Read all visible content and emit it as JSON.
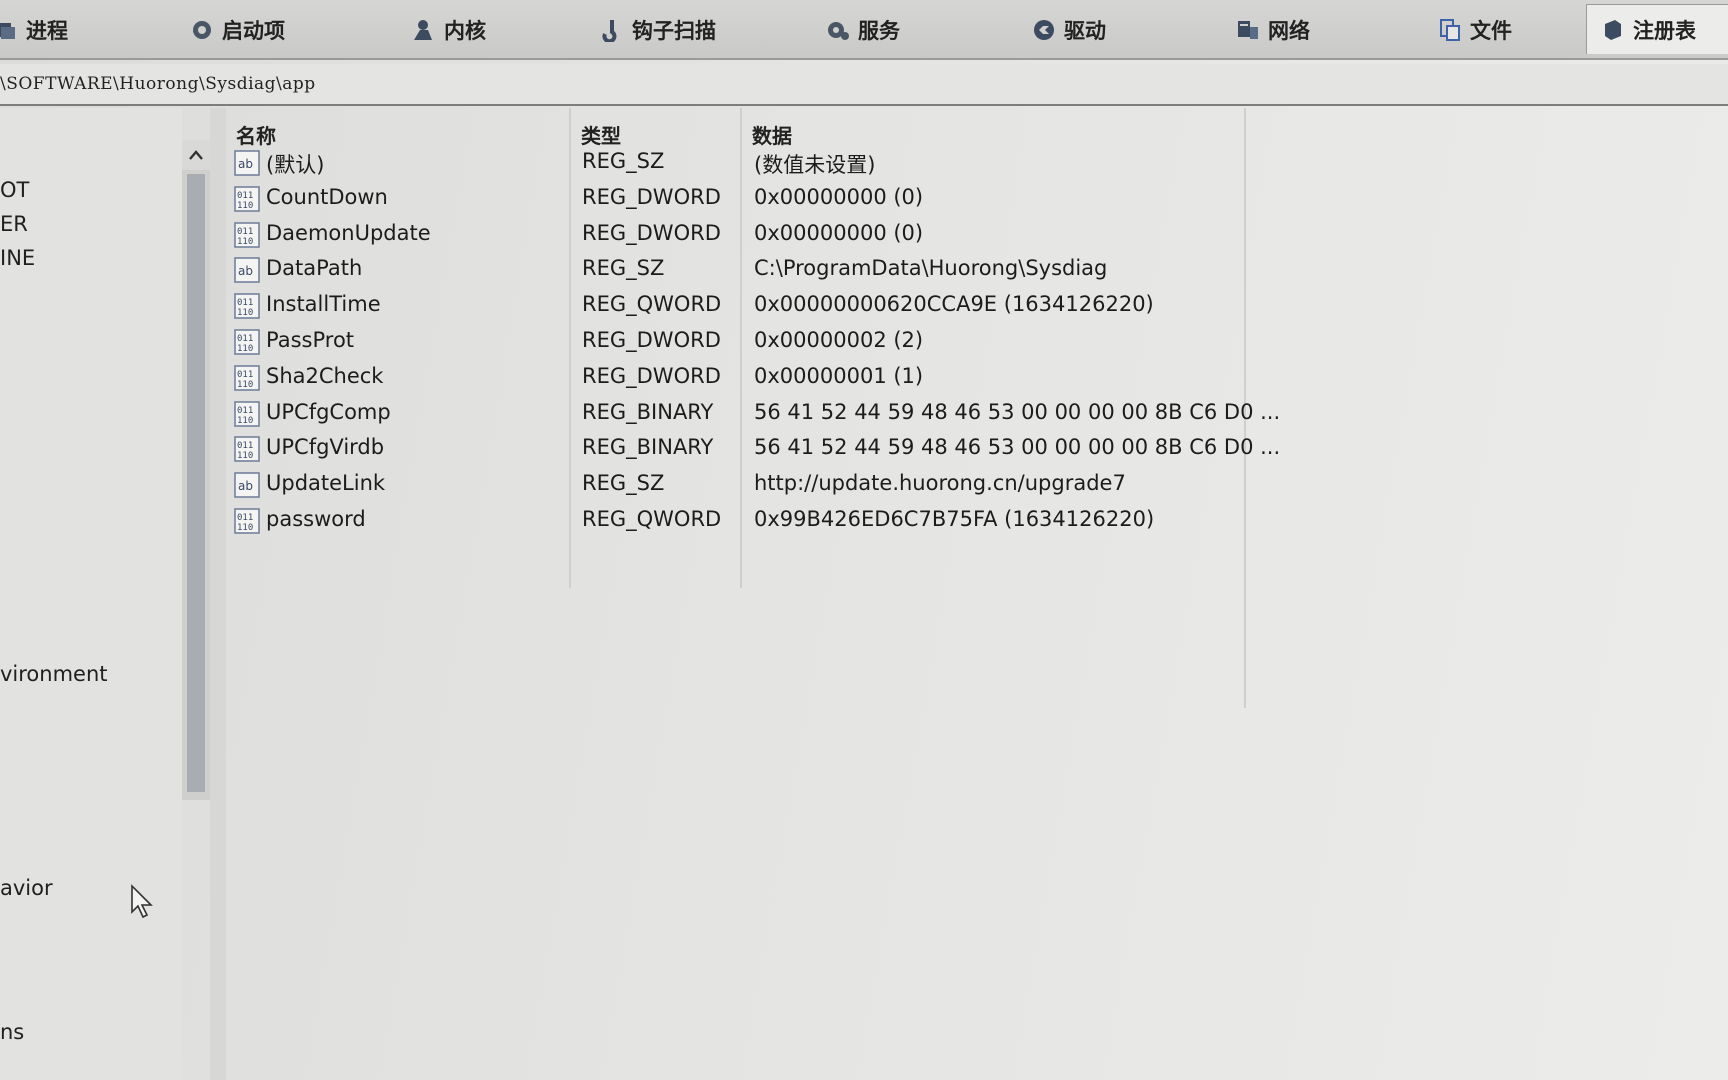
{
  "tabs": [
    {
      "label": "进程",
      "icon": "process-icon"
    },
    {
      "label": "启动项",
      "icon": "gear-icon"
    },
    {
      "label": "内核",
      "icon": "user-icon"
    },
    {
      "label": "钩子扫描",
      "icon": "hook-icon"
    },
    {
      "label": "服务",
      "icon": "service-gear-icon"
    },
    {
      "label": "驱动",
      "icon": "driver-icon"
    },
    {
      "label": "网络",
      "icon": "network-icon"
    },
    {
      "label": "文件",
      "icon": "file-icon"
    },
    {
      "label": "注册表",
      "icon": "registry-icon",
      "active": true
    }
  ],
  "address": {
    "path": "\\SOFTWARE\\Huorong\\Sysdiag\\app"
  },
  "tree": {
    "items": [
      {
        "label": "OT"
      },
      {
        "label": "ER"
      },
      {
        "label": "INE"
      },
      {
        "label": "vironment"
      },
      {
        "label": "avior"
      },
      {
        "label": "ns"
      }
    ]
  },
  "list": {
    "headers": {
      "name": "名称",
      "type": "类型",
      "data": "数据"
    },
    "rows": [
      {
        "name": "(默认)",
        "type": "REG_SZ",
        "data": "(数值未设置)",
        "icon": "string-value-icon"
      },
      {
        "name": "CountDown",
        "type": "REG_DWORD",
        "data": "0x00000000 (0)",
        "icon": "binary-value-icon"
      },
      {
        "name": "DaemonUpdate",
        "type": "REG_DWORD",
        "data": "0x00000000 (0)",
        "icon": "binary-value-icon"
      },
      {
        "name": "DataPath",
        "type": "REG_SZ",
        "data": "C:\\ProgramData\\Huorong\\Sysdiag",
        "icon": "string-value-icon"
      },
      {
        "name": "InstallTime",
        "type": "REG_QWORD",
        "data": "0x00000000620CCA9E (1634126220)",
        "icon": "binary-value-icon"
      },
      {
        "name": "PassProt",
        "type": "REG_DWORD",
        "data": "0x00000002 (2)",
        "icon": "binary-value-icon"
      },
      {
        "name": "Sha2Check",
        "type": "REG_DWORD",
        "data": "0x00000001 (1)",
        "icon": "binary-value-icon"
      },
      {
        "name": "UPCfgComp",
        "type": "REG_BINARY",
        "data": "56 41 52 44 59 48 46 53 00 00 00 00 8B C6 D0 ...",
        "icon": "binary-value-icon"
      },
      {
        "name": "UPCfgVirdb",
        "type": "REG_BINARY",
        "data": "56 41 52 44 59 48 46 53 00 00 00 00 8B C6 D0 ...",
        "icon": "binary-value-icon"
      },
      {
        "name": "UpdateLink",
        "type": "REG_SZ",
        "data": "http://update.huorong.cn/upgrade7",
        "icon": "string-value-icon"
      },
      {
        "name": "password",
        "type": "REG_QWORD",
        "data": "0x99B426ED6C7B75FA (1634126220)",
        "icon": "binary-value-icon"
      }
    ]
  }
}
